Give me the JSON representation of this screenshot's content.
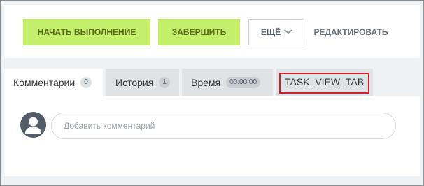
{
  "toolbar": {
    "start_label": "НАЧАТЬ ВЫПОЛНЕНИЕ",
    "finish_label": "ЗАВЕРШИТЬ",
    "more_label": "ЕЩЁ",
    "edit_label": "РЕДАКТИРОВАТЬ"
  },
  "tabs": [
    {
      "label": "Комментарии",
      "counter": "0"
    },
    {
      "label": "История",
      "counter": "1"
    },
    {
      "label": "Время",
      "counter": "00:00:00"
    },
    {
      "label": "TASK_VIEW_TAB"
    }
  ],
  "comment": {
    "placeholder": "Добавить комментарий"
  },
  "colors": {
    "primary_button": "#c3ef6a",
    "highlight_outline": "#d1202a",
    "avatar": "#535c69"
  }
}
